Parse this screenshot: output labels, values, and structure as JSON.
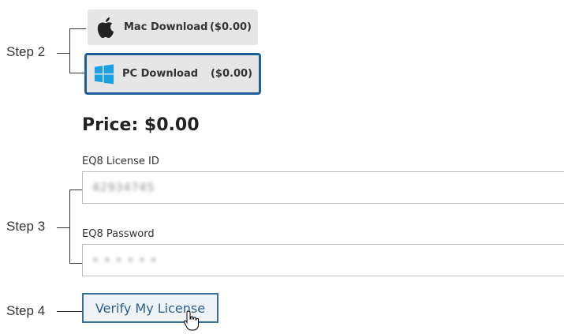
{
  "steps": {
    "step2": "Step 2",
    "step3": "Step 3",
    "step4": "Step 4"
  },
  "downloads": {
    "mac": {
      "label": "Mac Download",
      "price": "($0.00)",
      "icon": "apple-icon"
    },
    "pc": {
      "label": "PC Download",
      "price": "($0.00)",
      "icon": "windows-icon",
      "selected": true
    }
  },
  "price_heading": "Price: $0.00",
  "license_id": {
    "label": "EQ8 License ID",
    "value": "42934745"
  },
  "password": {
    "label": "EQ8 Password",
    "value": "• • • • • •"
  },
  "verify_button": "Verify My License",
  "colors": {
    "accent": "#1e5f9a",
    "button_text": "#2a5d8c",
    "windows_blue": "#1ba1e2"
  }
}
